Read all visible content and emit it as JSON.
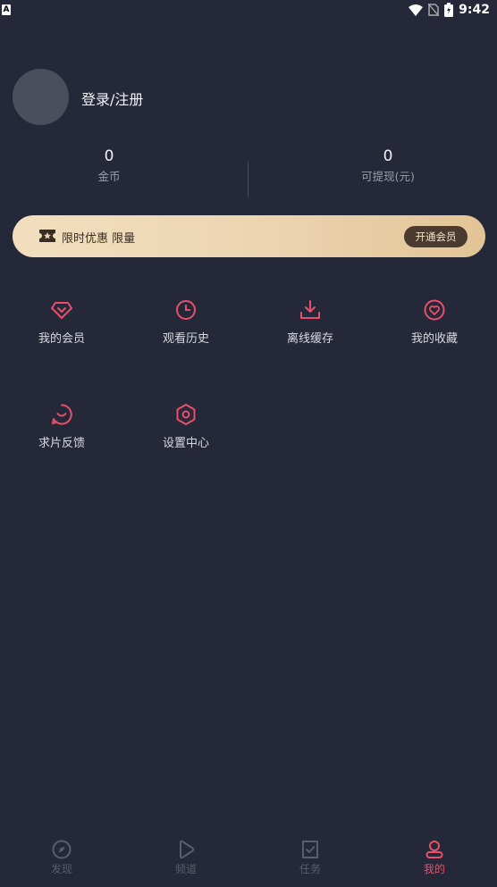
{
  "status_bar": {
    "time": "9:42",
    "left_badge": "A"
  },
  "profile": {
    "login_label": "登录/注册"
  },
  "stats": [
    {
      "value": "0",
      "label": "金币"
    },
    {
      "value": "0",
      "label": "可提现(元)"
    }
  ],
  "vip_banner": {
    "text": "限时优惠 限量",
    "button_label": "开通会员"
  },
  "menu": [
    {
      "label": "我的会员",
      "icon": "diamond-icon"
    },
    {
      "label": "观看历史",
      "icon": "clock-icon"
    },
    {
      "label": "离线缓存",
      "icon": "download-icon"
    },
    {
      "label": "我的收藏",
      "icon": "heart-icon"
    },
    {
      "label": "求片反馈",
      "icon": "feedback-icon"
    },
    {
      "label": "设置中心",
      "icon": "settings-hex-icon"
    }
  ],
  "tabs": [
    {
      "label": "发现",
      "icon": "compass-icon",
      "active": false
    },
    {
      "label": "频道",
      "icon": "play-icon",
      "active": false
    },
    {
      "label": "任务",
      "icon": "task-check-icon",
      "active": false
    },
    {
      "label": "我的",
      "icon": "person-icon",
      "active": true
    }
  ],
  "colors": {
    "background": "#252838",
    "accent": "#e8506a",
    "inactive": "#5a5d6c",
    "banner_gold": "#ecd4b0"
  }
}
